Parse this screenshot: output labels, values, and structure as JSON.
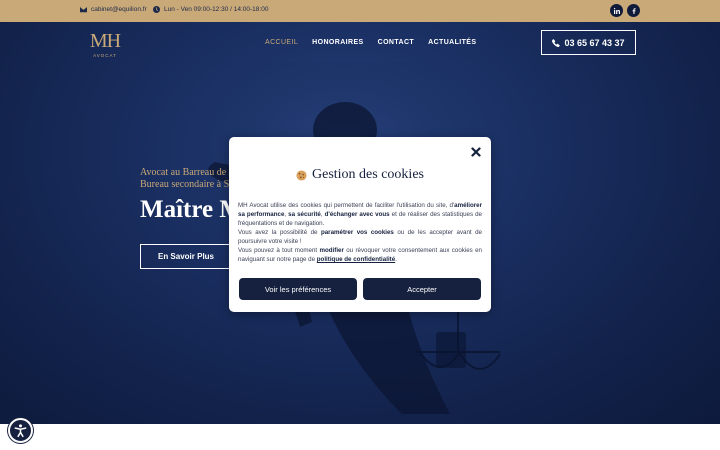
{
  "topbar": {
    "email": "cabinet@equilion.fr",
    "hours": "Lun - Ven 09:00-12:30 / 14:00-18:00",
    "icons": [
      "envelope-icon",
      "clock-icon",
      "linkedin-icon",
      "facebook-icon"
    ]
  },
  "logo": {
    "mark": "MH",
    "sub": "AVOCAT"
  },
  "nav": {
    "items": [
      "ACCUEIL",
      "HONORAIRES",
      "CONTACT",
      "ACTUALITÉS"
    ],
    "active": "ACCUEIL"
  },
  "phone": {
    "number": "03 65 67 43 37",
    "icon": "phone-icon"
  },
  "hero": {
    "line1": "Avocat au Barreau de",
    "line2": "Bureau secondaire à S",
    "title": "Maître M",
    "cta": "En Savoir Plus"
  },
  "cookie_modal": {
    "title": "Gestion des cookies",
    "body": {
      "p1_a": "MH Avocat utilise des cookies qui permettent de faciliter l'utilisation du site, d'",
      "p1_b1": "améliorer sa performance",
      "p1_c": ", ",
      "p1_b2": "sa sécurité",
      "p1_d": ", ",
      "p1_b3": "d'échanger avec vous",
      "p1_e": " et de réaliser des statistiques de fréquentations et de navigation.",
      "p2_a": "Vous avez la possibilité de ",
      "p2_b": "paramétrer vos cookies",
      "p2_c": " ou de les accepter avant de poursuivre votre visite !",
      "p3_a": "Vous pouvez à tout moment ",
      "p3_b": "modifier",
      "p3_c": " ou révoquer votre consentement aux cookies en naviguant sur notre page de ",
      "p3_link": "politique de confidentialité",
      "p3_end": "."
    },
    "btn_prefs": "Voir les préférences",
    "btn_accept": "Accepter",
    "icons": [
      "close-icon",
      "cookie-icon"
    ]
  },
  "colors": {
    "gold": "#c9a978",
    "navy": "#16213f",
    "hero_blue": "#1a2f62",
    "white": "#ffffff"
  },
  "accessibility": {
    "icon": "accessibility-icon"
  }
}
